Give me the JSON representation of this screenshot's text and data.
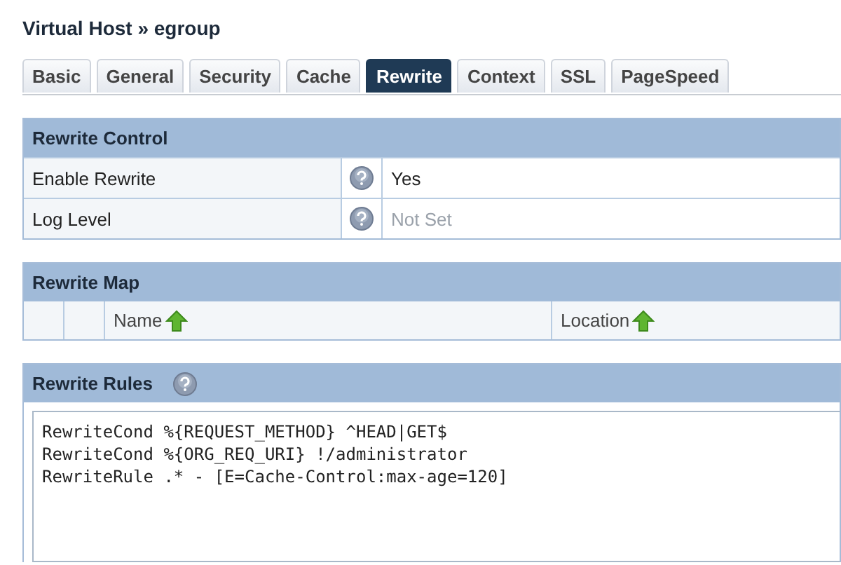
{
  "title": "Virtual Host » egroup",
  "tabs": [
    {
      "label": "Basic",
      "selected": false
    },
    {
      "label": "General",
      "selected": false
    },
    {
      "label": "Security",
      "selected": false
    },
    {
      "label": "Cache",
      "selected": false
    },
    {
      "label": "Rewrite",
      "selected": true
    },
    {
      "label": "Context",
      "selected": false
    },
    {
      "label": "SSL",
      "selected": false
    },
    {
      "label": "PageSpeed",
      "selected": false
    }
  ],
  "rewrite_control": {
    "title": "Rewrite Control",
    "rows": [
      {
        "label": "Enable Rewrite",
        "value": "Yes",
        "unset": false
      },
      {
        "label": "Log Level",
        "value": "Not Set",
        "unset": true
      }
    ]
  },
  "rewrite_map": {
    "title": "Rewrite Map",
    "columns": [
      "Name",
      "Location"
    ]
  },
  "rewrite_rules": {
    "title": "Rewrite Rules",
    "lines": [
      "RewriteCond %{REQUEST_METHOD} ^HEAD|GET$",
      "RewriteCond %{ORG_REQ_URI} !/administrator",
      "RewriteRule .* - [E=Cache-Control:max-age=120]"
    ]
  }
}
